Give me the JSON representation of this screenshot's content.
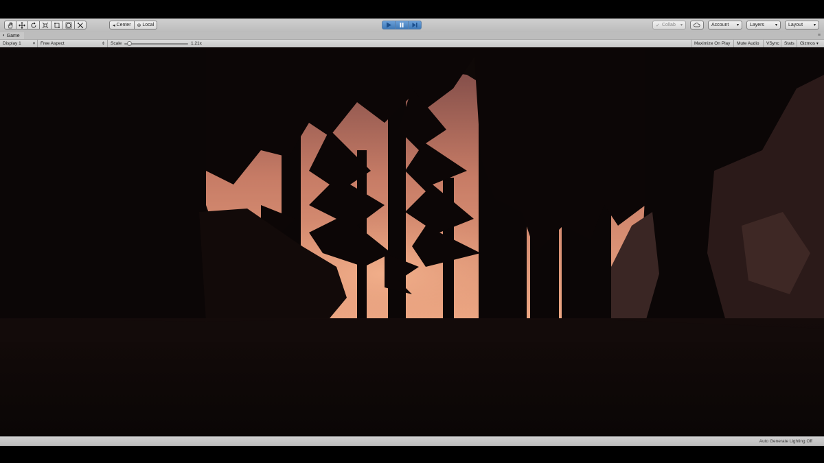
{
  "toolbar": {
    "tools": [
      {
        "name": "hand-tool-icon"
      },
      {
        "name": "move-tool-icon"
      },
      {
        "name": "rotate-tool-icon"
      },
      {
        "name": "scale-tool-icon"
      },
      {
        "name": "rect-tool-icon"
      },
      {
        "name": "transform-tool-icon"
      },
      {
        "name": "custom-tool-icon"
      }
    ],
    "pivot_label": "Center",
    "rotation_label": "Local",
    "play_state": "playing",
    "collab_label": "Collab",
    "account_label": "Account",
    "layers_label": "Layers",
    "layout_label": "Layout"
  },
  "tab": {
    "title": "Game"
  },
  "game_toolbar": {
    "display": "Display 1",
    "aspect": "Free Aspect",
    "scale_label": "Scale",
    "scale_value": "1.21x",
    "scale_fraction": 0.08,
    "maximize_on_play": "Maximize On Play",
    "mute_audio": "Mute Audio",
    "vsync": "VSync",
    "stats": "Stats",
    "gizmos": "Gizmos"
  },
  "status": {
    "text": "Auto Generate Lighting Off"
  },
  "colors": {
    "sky": "#e8a07e",
    "sky_dark": "#b7675a",
    "silhouette": "#0d0706",
    "play_active": "#3d78b8"
  }
}
